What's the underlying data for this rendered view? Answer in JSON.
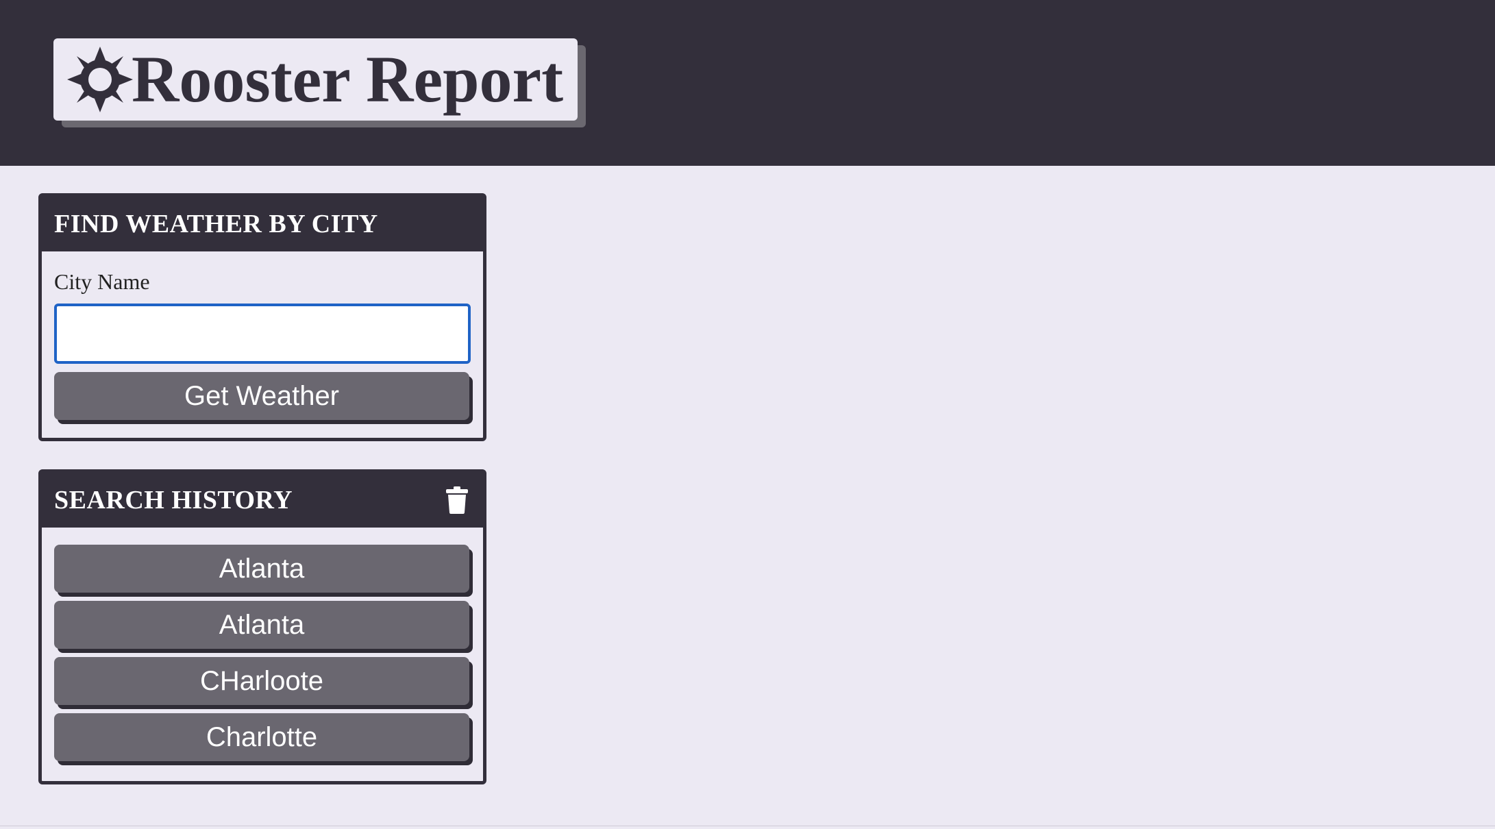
{
  "header": {
    "title": "Rooster Report",
    "icon": "sun-icon"
  },
  "search": {
    "title": "FIND WEATHER BY CITY",
    "city_label": "City Name",
    "city_value": "",
    "submit_label": "Get Weather"
  },
  "history": {
    "title": "SEARCH HISTORY",
    "clear_icon": "trash-icon",
    "items": [
      {
        "label": "Atlanta"
      },
      {
        "label": "Atlanta"
      },
      {
        "label": "CHarloote"
      },
      {
        "label": "Charlotte"
      }
    ]
  },
  "colors": {
    "header_bg": "#332f3b",
    "page_bg": "#ece9f3",
    "button_bg": "#6a6770",
    "input_focus": "#1f63c6"
  }
}
